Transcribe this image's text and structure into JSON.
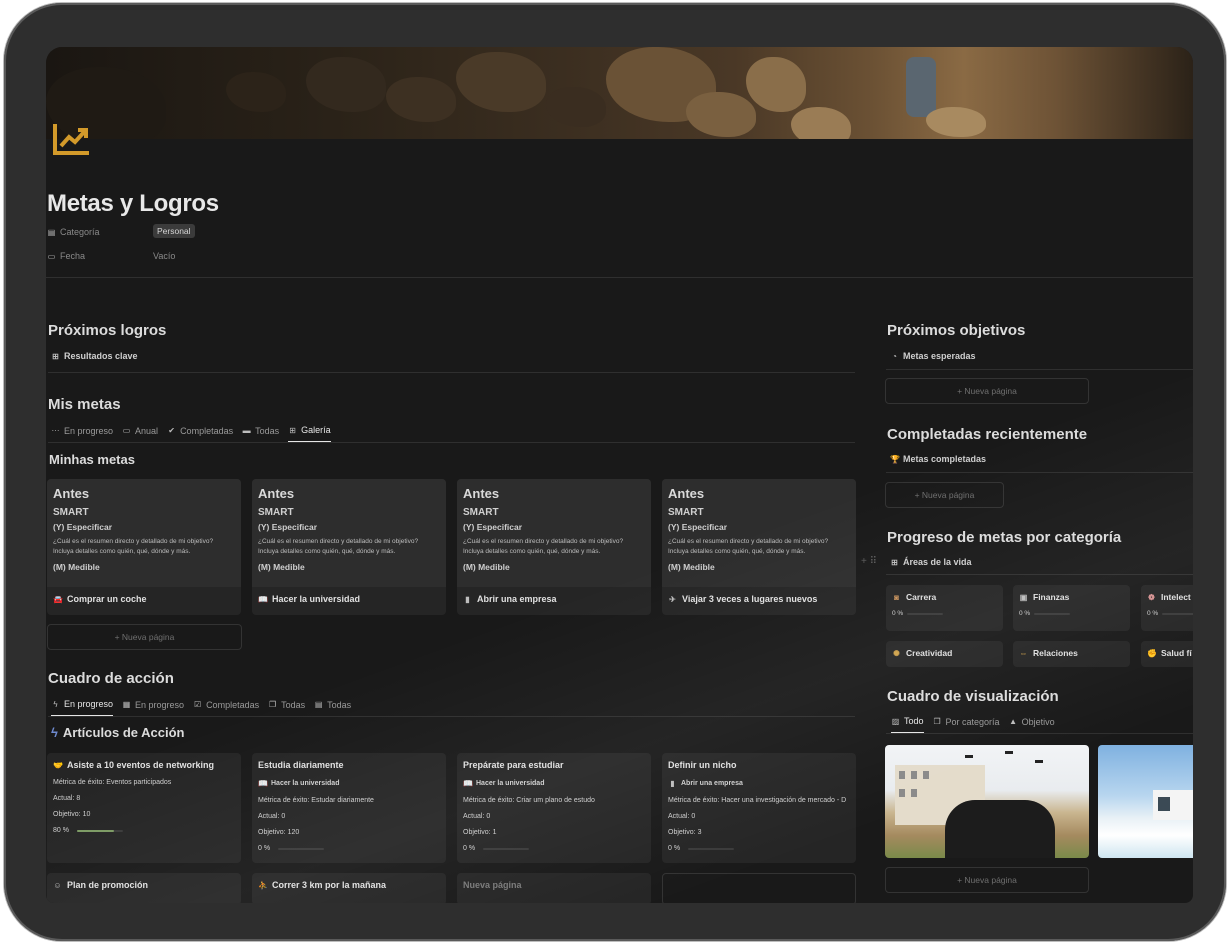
{
  "page": {
    "title": "Metas y Logros",
    "props": [
      {
        "label": "Categoría",
        "value": "Personal",
        "icon": "category-icon"
      },
      {
        "label": "Fecha",
        "value": "Vacío",
        "icon": "calendar-icon"
      }
    ]
  },
  "colors": {
    "accent": "#d39a2a",
    "background": "#191919",
    "card": "#252525",
    "progress": "#7c9a63"
  },
  "proximos_logros": {
    "title": "Próximos logros",
    "link": "Resultados clave"
  },
  "mis_metas": {
    "title": "Mis metas",
    "tabs": [
      "En progreso",
      "Anual",
      "Completadas",
      "Todas",
      "Galería"
    ],
    "active_tab": "Galería",
    "gallery_title": "Minhas metas",
    "preview": {
      "l1": "Antes",
      "l2": "SMART",
      "l3": "(Y) Especificar",
      "l4": "¿Cuál es el resumen directo y detallado de mi objetivo? Incluya detalles como quién, qué, dónde y más.",
      "l5": "(M) Medible"
    },
    "cards": [
      "Comprar un coche",
      "Hacer la universidad",
      "Abrir una empresa",
      "Viajar 3 veces a lugares nuevos"
    ],
    "new_page": "+ Nueva página"
  },
  "cuadro_accion": {
    "title": "Cuadro de acción",
    "tabs": [
      "En progreso",
      "En progreso",
      "Completadas",
      "Todas",
      "Todas"
    ],
    "board_title": "Artículos de Acción",
    "cards": [
      {
        "title": "Asiste a 10 eventos de networking",
        "rel": "",
        "metric": "Métrica de éxito: Eventos participados",
        "actual": "Actual: 8",
        "objetivo": "Objetivo: 10",
        "pct": "80 %",
        "progress": 0.8
      },
      {
        "title": "Estudia diariamente",
        "rel": "Hacer la universidad",
        "metric": "Métrica de éxito: Estudar diariamente",
        "actual": "Actual: 0",
        "objetivo": "Objetivo: 120",
        "pct": "0 %",
        "progress": 0
      },
      {
        "title": "Prepárate para estudiar",
        "rel": "Hacer la universidad",
        "metric": "Métrica de éxito: Criar um plano de estudo",
        "actual": "Actual: 0",
        "objetivo": "Objetivo: 1",
        "pct": "0 %",
        "progress": 0
      },
      {
        "title": "Definir un nicho",
        "rel": "Abrir una empresa",
        "metric": "Métrica de éxito: Hacer una investigación de mercado - D",
        "actual": "Actual: 0",
        "objetivo": "Objetivo: 3",
        "pct": "0 %",
        "progress": 0
      }
    ],
    "bottom_cards": [
      "Plan de promoción",
      "Correr 3 km por la mañana",
      "Nueva página",
      ""
    ]
  },
  "right": {
    "proximos_objetivos": {
      "title": "Próximos objetivos",
      "link": "Metas esperadas",
      "new_page": "+ Nueva página"
    },
    "completadas": {
      "title": "Completadas recientemente",
      "link": "Metas completadas",
      "new_page": "+ Nueva página"
    },
    "progreso": {
      "title": "Progreso de metas por categoría",
      "link": "Áreas de la vida",
      "cats": [
        {
          "name": "Carrera",
          "pct": "0 %"
        },
        {
          "name": "Finanzas",
          "pct": "0 %"
        },
        {
          "name": "Intelect",
          "pct": "0 %"
        },
        {
          "name": "Creatividad",
          "pct": ""
        },
        {
          "name": "Relaciones",
          "pct": ""
        },
        {
          "name": "Salud fí",
          "pct": ""
        }
      ]
    },
    "visualizacion": {
      "title": "Cuadro de visualización",
      "tabs": [
        "Todo",
        "Por categoría",
        "Objetivo"
      ],
      "new_page": "+ Nueva página"
    }
  }
}
